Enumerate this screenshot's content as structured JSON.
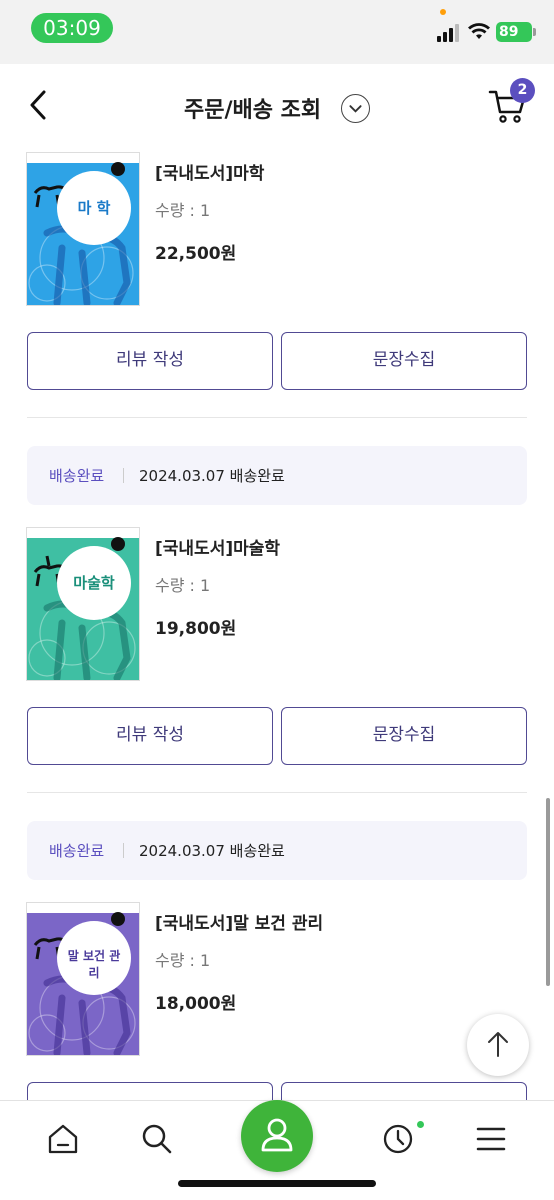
{
  "status_bar": {
    "time": "03:09",
    "battery": "89"
  },
  "header": {
    "title": "주문/배송 조회",
    "cart_count": "2"
  },
  "orders": [
    {
      "product": {
        "name": "[국내도서]마학",
        "quantity": "수량 : 1",
        "price": "22,500원",
        "cover_title": "마 학",
        "cover_color": "#2ea3e6"
      },
      "buttons": {
        "review": "리뷰 작성",
        "collect": "문장수집"
      }
    },
    {
      "status": {
        "label": "배송완료",
        "date": "2024.03.07 배송완료"
      },
      "product": {
        "name": "[국내도서]마술학",
        "quantity": "수량 : 1",
        "price": "19,800원",
        "cover_title": "마술학",
        "cover_color": "#3fbfa3"
      },
      "buttons": {
        "review": "리뷰 작성",
        "collect": "문장수집"
      }
    },
    {
      "status": {
        "label": "배송완료",
        "date": "2024.03.07 배송완료"
      },
      "product": {
        "name": "[국내도서]말 보건 관리",
        "quantity": "수량 : 1",
        "price": "18,000원",
        "cover_title": "말 보건 관리",
        "cover_color": "#7b66c7"
      }
    }
  ],
  "colors": {
    "accent": "#5b4fbf",
    "nav_center": "#3fb43a",
    "status_pill": "#34c759"
  },
  "icons": [
    "back-icon",
    "chevron-down-icon",
    "cart-icon",
    "arrow-up-icon",
    "home-icon",
    "search-icon",
    "person-icon",
    "clock-icon",
    "menu-icon"
  ]
}
